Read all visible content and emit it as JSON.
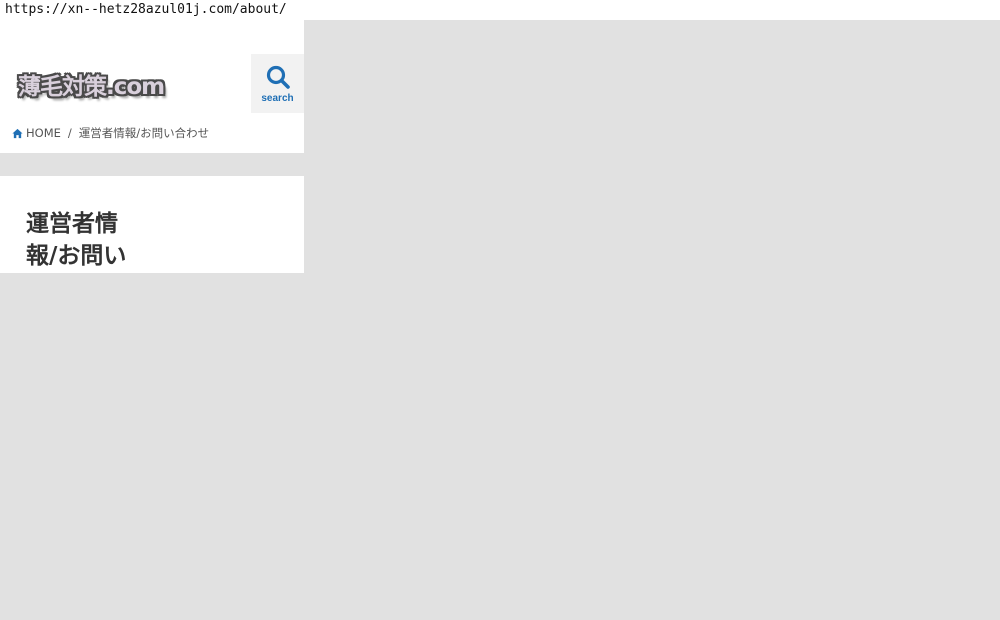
{
  "browser": {
    "url": "https://xn--hetz28azul01j.com/about/"
  },
  "header": {
    "logo_text": "薄毛対策.com",
    "search_label": "search"
  },
  "breadcrumb": {
    "home_label": "HOME",
    "separator": "/",
    "current": "運営者情報/お問い合わせ"
  },
  "main": {
    "title": "運営者情報/お問い"
  },
  "colors": {
    "accent": "#1f6fb5",
    "page_bg": "#e1e1e1",
    "card_bg": "#ffffff"
  }
}
